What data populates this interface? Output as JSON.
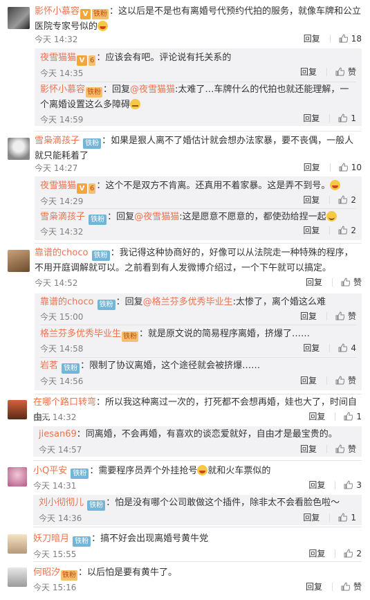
{
  "actions": {
    "reply": "回复",
    "like": "赞"
  },
  "comments": [
    {
      "name": "影怀小慕容",
      "text": "：这以后是不是也有离婚号代预约代拍的服务，就像车牌和公立医院专家号似的",
      "time": "今天 14:32",
      "likes": "18",
      "replies": [
        {
          "name": "夜雪猫猫",
          "text": "：应该会有吧。评论说有托关系的",
          "time": "今天 14:35",
          "likes": "赞"
        },
        {
          "name": "影怀小慕容",
          "pre": "：回复",
          "at": "@夜雪猫猫",
          "text": ":太难了…车牌什么的代拍也就还能理解，一个离婚设置这么多障碍",
          "time": "今天 14:59",
          "likes": "1"
        }
      ]
    },
    {
      "name": "雪枭滴孩子",
      "text": "：如果是狠人离不了婚估计就会想办法家暴，要不丧偶，一般人就只能耗着了",
      "time": "今天 14:27",
      "likes": "10",
      "replies": [
        {
          "name": "夜雪猫猫",
          "text": "：这个不是双方不肯离。还真用不着家暴。这是弄不到号。",
          "time": "今天 14:29",
          "likes": "2"
        },
        {
          "name": "雪枭滴孩子",
          "pre": "：回复",
          "at": "@夜雪猫猫",
          "text": ":这是愿意不愿意的，都使劲给捏一起",
          "time": "今天 14:32",
          "likes": "2"
        }
      ]
    },
    {
      "name": "靠谱的choco",
      "text": "：我记得这种协商好的，好像可以从法院走一种特殊的程序，不用开庭调解就可以。之前看到有人发微博介绍过，一个下午就可以搞定。",
      "time": "今天 14:52",
      "likes": "赞",
      "replies": [
        {
          "name": "靠谱的choco",
          "pre": "：回复",
          "at": "@格兰芬多优秀毕业生",
          "text": ":太惨了，离个婚这么难",
          "time": "今天 15:00",
          "likes": "赞"
        },
        {
          "name": "格兰芬多优秀毕业生",
          "text": "：就是原文说的简易程序离婚，挤爆了……",
          "time": "今天 14:58",
          "likes": "4"
        },
        {
          "name": "岩茗",
          "text": "：限制了协议离婚，这个途径就会被挤爆……",
          "time": "今天 14:56",
          "likes": "赞"
        }
      ]
    },
    {
      "name": "在哪个路口转弯",
      "text": "：所以我这种离过一次的，打死都不会想再婚，娃也大了，时间自由...",
      "time": "今天 14:32",
      "likes": "1",
      "replies": [
        {
          "name": "jiesan69",
          "text": "：同离婚，不会再婚，有喜欢的谈恋爱就好，自由才是最宝贵的。",
          "time": "今天 14:57",
          "likes": "赞"
        }
      ]
    },
    {
      "name": "小Q平安",
      "text": "：需要程序员弄个外挂抢号",
      "text2": "就和火车票似的",
      "time": "今天 14:31",
      "likes": "3",
      "replies": [
        {
          "name": "刘小彻彻儿",
          "text": "：怕是没有哪个公司敢做这个插件，除非太不会看脸色啦～",
          "time": "今天 14:36",
          "likes": "1"
        }
      ]
    },
    {
      "name": "妖刀暗月",
      "text": "：搞不好会出现离婚号黄牛党",
      "time": "今天 15:55",
      "likes": "2",
      "replies": []
    },
    {
      "name": "何昭汐",
      "text": "：以后怕是要有黄牛了。",
      "time": "今天 15:16",
      "likes": "赞",
      "replies": []
    }
  ],
  "badges": {
    "fan": "铁粉",
    "vip": "V",
    "level": "6"
  },
  "colors": {
    "name": "#eb7350",
    "reply_bg": "#f2f2f5",
    "time": "#808080",
    "fan_badge": "#73b5d6"
  }
}
